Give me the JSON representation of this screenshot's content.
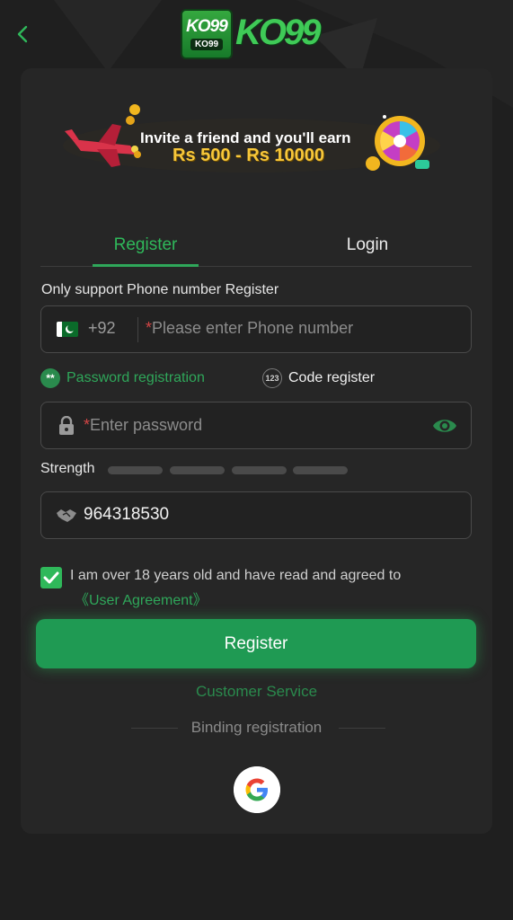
{
  "header": {
    "logo_badge_text": "KO99",
    "logo_badge_sub": "KO99",
    "logo_wordmark": "KO99"
  },
  "banner": {
    "line1": "Invite a friend and you'll earn",
    "line2": "Rs 500 - Rs 10000"
  },
  "tabs": [
    {
      "label": "Register",
      "active": true
    },
    {
      "label": "Login",
      "active": false
    }
  ],
  "form": {
    "hint": "Only support Phone number Register",
    "phone": {
      "dial_code": "+92",
      "required_mark": "*",
      "placeholder": "Please enter Phone number",
      "flag": "pakistan-flag-icon"
    },
    "modes": [
      {
        "label": "Password registration",
        "icon": "**",
        "active": true
      },
      {
        "label": "Code register",
        "icon": "123",
        "active": false
      }
    ],
    "password": {
      "required_mark": "*",
      "placeholder": "Enter password"
    },
    "strength_label": "Strength",
    "strength_level": 0,
    "invite_code": {
      "value": "964318530"
    },
    "agreement": {
      "checked": true,
      "text": "I am over 18 years old and have read and agreed to",
      "link": "《User Agreement》"
    },
    "submit_label": "Register"
  },
  "footer": {
    "customer_service": "Customer Service",
    "binding_label": "Binding registration"
  },
  "colors": {
    "accent": "#1f9a53",
    "background": "#1f1f1f",
    "card": "#262626"
  }
}
